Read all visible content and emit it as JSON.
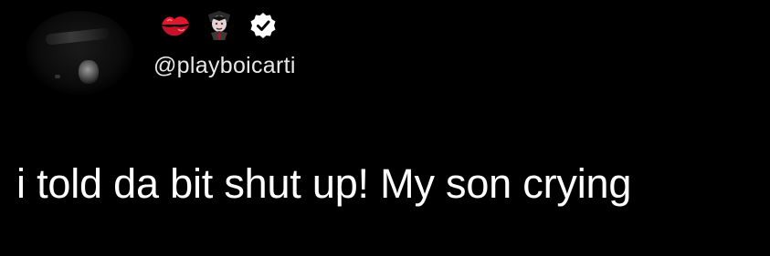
{
  "tweet": {
    "handle": "@playboicarti",
    "text": "i told da bit shut up! My son crying",
    "emojis": [
      "kiss-mark-icon",
      "vampire-icon",
      "verified-badge-icon"
    ]
  },
  "colors": {
    "background": "#000000",
    "text": "#ffffff",
    "handle": "#e8e8e8",
    "kiss": "#e0182d",
    "verified": "#ffffff"
  }
}
